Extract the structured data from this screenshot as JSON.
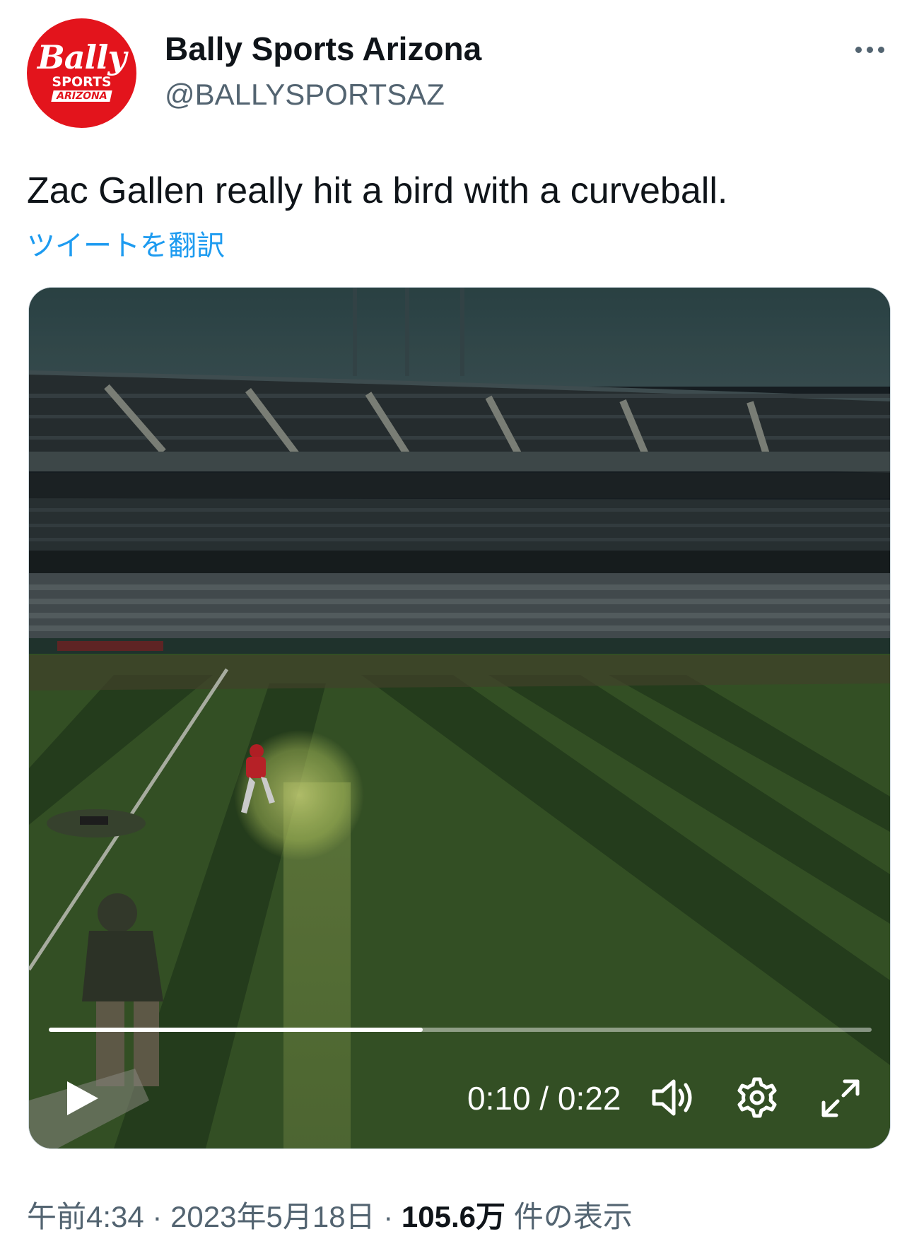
{
  "account": {
    "display_name": "Bally Sports Arizona",
    "handle": "@BALLYSPORTSAZ",
    "avatar": {
      "logo_script": "Bally",
      "logo_sub": "SPORTS",
      "logo_region": "ARIZONA",
      "color": "#e3141c"
    }
  },
  "tweet": {
    "text": "Zac Gallen really hit a bird with a curveball.",
    "translate_label": "ツイートを翻訳"
  },
  "video": {
    "current_time": "0:10",
    "duration": "0:22",
    "time_display": "0:10 / 0:22",
    "progress_fraction": 0.4545,
    "controls": [
      "play-icon",
      "volume-icon",
      "gear-icon",
      "fullscreen-icon"
    ]
  },
  "meta": {
    "time": "午前4:34",
    "separator": " · ",
    "date": "2023年5月18日",
    "views_count": "105.6万",
    "views_label": " 件の表示"
  },
  "colors": {
    "link": "#1d9bf0",
    "secondary_text": "#536471",
    "primary_text": "#0f1419"
  }
}
